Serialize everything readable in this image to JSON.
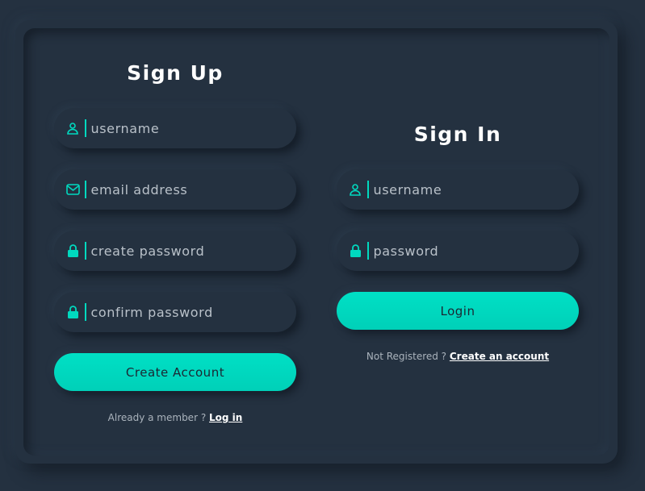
{
  "signup": {
    "title": "Sign Up",
    "username_placeholder": "username",
    "email_placeholder": "email address",
    "password_placeholder": "create password",
    "confirm_placeholder": "confirm password",
    "button_label": "Create Account",
    "note_text": "Already a member ? ",
    "note_link": "Log in"
  },
  "signin": {
    "title": "Sign In",
    "username_placeholder": "username",
    "password_placeholder": "password",
    "button_label": "Login",
    "note_text": "Not Registered ? ",
    "note_link": "Create an account"
  },
  "colors": {
    "background": "#243140",
    "accent": "#00d9bf",
    "text": "#ffffff"
  },
  "icons": [
    "user-icon",
    "mail-icon",
    "lock-icon"
  ]
}
